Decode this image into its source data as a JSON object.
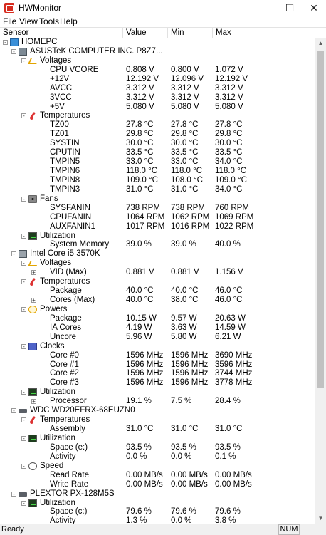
{
  "window": {
    "title": "HWMonitor",
    "minimize": "—",
    "maximize": "☐",
    "close": "✕"
  },
  "menu": [
    "File",
    "View",
    "Tools",
    "Help"
  ],
  "columns": {
    "sensor": "Sensor",
    "value": "Value",
    "min": "Min",
    "max": "Max"
  },
  "tree": [
    {
      "level": 0,
      "kind": "root",
      "icon": "computer",
      "label": "HOMEPC",
      "toggle": "-"
    },
    {
      "level": 1,
      "kind": "device",
      "icon": "board",
      "label": "ASUSTeK COMPUTER INC. P8Z7...",
      "toggle": "-"
    },
    {
      "level": 2,
      "kind": "group",
      "icon": "volt",
      "label": "Voltages",
      "toggle": "-"
    },
    {
      "level": 3,
      "label": "CPU VCORE",
      "value": "0.808 V",
      "min": "0.800 V",
      "max": "1.072 V"
    },
    {
      "level": 3,
      "label": "+12V",
      "value": "12.192 V",
      "min": "12.096 V",
      "max": "12.192 V"
    },
    {
      "level": 3,
      "label": "AVCC",
      "value": "3.312 V",
      "min": "3.312 V",
      "max": "3.312 V"
    },
    {
      "level": 3,
      "label": "3VCC",
      "value": "3.312 V",
      "min": "3.312 V",
      "max": "3.312 V"
    },
    {
      "level": 3,
      "label": "+5V",
      "value": "5.080 V",
      "min": "5.080 V",
      "max": "5.080 V"
    },
    {
      "level": 2,
      "kind": "group",
      "icon": "temp",
      "label": "Temperatures",
      "toggle": "-"
    },
    {
      "level": 3,
      "label": "TZ00",
      "value": "27.8 °C",
      "min": "27.8 °C",
      "max": "27.8 °C"
    },
    {
      "level": 3,
      "label": "TZ01",
      "value": "29.8 °C",
      "min": "29.8 °C",
      "max": "29.8 °C"
    },
    {
      "level": 3,
      "label": "SYSTIN",
      "value": "30.0 °C",
      "min": "30.0 °C",
      "max": "30.0 °C"
    },
    {
      "level": 3,
      "label": "CPUTIN",
      "value": "33.5 °C",
      "min": "33.5 °C",
      "max": "33.5 °C"
    },
    {
      "level": 3,
      "label": "TMPIN5",
      "value": "33.0 °C",
      "min": "33.0 °C",
      "max": "34.0 °C"
    },
    {
      "level": 3,
      "label": "TMPIN6",
      "value": "118.0 °C",
      "min": "118.0 °C",
      "max": "118.0 °C"
    },
    {
      "level": 3,
      "label": "TMPIN8",
      "value": "109.0 °C",
      "min": "108.0 °C",
      "max": "109.0 °C"
    },
    {
      "level": 3,
      "label": "TMPIN3",
      "value": "31.0 °C",
      "min": "31.0 °C",
      "max": "34.0 °C"
    },
    {
      "level": 2,
      "kind": "group",
      "icon": "fan",
      "label": "Fans",
      "toggle": "-"
    },
    {
      "level": 3,
      "label": "SYSFANIN",
      "value": "738 RPM",
      "min": "738 RPM",
      "max": "760 RPM"
    },
    {
      "level": 3,
      "label": "CPUFANIN",
      "value": "1064 RPM",
      "min": "1062 RPM",
      "max": "1069 RPM"
    },
    {
      "level": 3,
      "label": "AUXFANIN1",
      "value": "1017 RPM",
      "min": "1016 RPM",
      "max": "1022 RPM"
    },
    {
      "level": 2,
      "kind": "group",
      "icon": "util",
      "label": "Utilization",
      "toggle": "-"
    },
    {
      "level": 3,
      "label": "System Memory",
      "value": "39.0 %",
      "min": "39.0 %",
      "max": "40.0 %"
    },
    {
      "level": 1,
      "kind": "device",
      "icon": "cpu",
      "label": "Intel Core i5 3570K",
      "toggle": "-"
    },
    {
      "level": 2,
      "kind": "group",
      "icon": "volt",
      "label": "Voltages",
      "toggle": "-"
    },
    {
      "level": 3,
      "label": "VID (Max)",
      "value": "0.881 V",
      "min": "0.881 V",
      "max": "1.156 V",
      "toggle": "+"
    },
    {
      "level": 2,
      "kind": "group",
      "icon": "temp",
      "label": "Temperatures",
      "toggle": "-"
    },
    {
      "level": 3,
      "label": "Package",
      "value": "40.0 °C",
      "min": "40.0 °C",
      "max": "46.0 °C"
    },
    {
      "level": 3,
      "label": "Cores (Max)",
      "value": "40.0 °C",
      "min": "38.0 °C",
      "max": "46.0 °C",
      "toggle": "+"
    },
    {
      "level": 2,
      "kind": "group",
      "icon": "power",
      "label": "Powers",
      "toggle": "-"
    },
    {
      "level": 3,
      "label": "Package",
      "value": "10.15 W",
      "min": "9.57 W",
      "max": "20.63 W"
    },
    {
      "level": 3,
      "label": "IA Cores",
      "value": "4.19 W",
      "min": "3.63 W",
      "max": "14.59 W"
    },
    {
      "level": 3,
      "label": "Uncore",
      "value": "5.96 W",
      "min": "5.80 W",
      "max": "6.21 W"
    },
    {
      "level": 2,
      "kind": "group",
      "icon": "clock",
      "label": "Clocks",
      "toggle": "-"
    },
    {
      "level": 3,
      "label": "Core #0",
      "value": "1596 MHz",
      "min": "1596 MHz",
      "max": "3690 MHz"
    },
    {
      "level": 3,
      "label": "Core #1",
      "value": "1596 MHz",
      "min": "1596 MHz",
      "max": "3596 MHz"
    },
    {
      "level": 3,
      "label": "Core #2",
      "value": "1596 MHz",
      "min": "1596 MHz",
      "max": "3744 MHz"
    },
    {
      "level": 3,
      "label": "Core #3",
      "value": "1596 MHz",
      "min": "1596 MHz",
      "max": "3778 MHz"
    },
    {
      "level": 2,
      "kind": "group",
      "icon": "util",
      "label": "Utilization",
      "toggle": "-"
    },
    {
      "level": 3,
      "label": "Processor",
      "value": "19.1 %",
      "min": "7.5 %",
      "max": "28.4 %",
      "toggle": "+"
    },
    {
      "level": 1,
      "kind": "device",
      "icon": "disk",
      "label": "WDC WD20EFRX-68EUZN0",
      "toggle": "-"
    },
    {
      "level": 2,
      "kind": "group",
      "icon": "temp",
      "label": "Temperatures",
      "toggle": "-"
    },
    {
      "level": 3,
      "label": "Assembly",
      "value": "31.0 °C",
      "min": "31.0 °C",
      "max": "31.0 °C"
    },
    {
      "level": 2,
      "kind": "group",
      "icon": "util",
      "label": "Utilization",
      "toggle": "-"
    },
    {
      "level": 3,
      "label": "Space (e:)",
      "value": "93.5 %",
      "min": "93.5 %",
      "max": "93.5 %"
    },
    {
      "level": 3,
      "label": "Activity",
      "value": "0.0 %",
      "min": "0.0 %",
      "max": "0.1 %"
    },
    {
      "level": 2,
      "kind": "group",
      "icon": "speed",
      "label": "Speed",
      "toggle": "-"
    },
    {
      "level": 3,
      "label": "Read Rate",
      "value": "0.00 MB/s",
      "min": "0.00 MB/s",
      "max": "0.00 MB/s"
    },
    {
      "level": 3,
      "label": "Write Rate",
      "value": "0.00 MB/s",
      "min": "0.00 MB/s",
      "max": "0.00 MB/s"
    },
    {
      "level": 1,
      "kind": "device",
      "icon": "disk",
      "label": "PLEXTOR PX-128M5S",
      "toggle": "-"
    },
    {
      "level": 2,
      "kind": "group",
      "icon": "util",
      "label": "Utilization",
      "toggle": "-"
    },
    {
      "level": 3,
      "label": "Space (c:)",
      "value": "79.6 %",
      "min": "79.6 %",
      "max": "79.6 %"
    },
    {
      "level": 3,
      "label": "Activity",
      "value": "1.3 %",
      "min": "0.0 %",
      "max": "3.8 %"
    }
  ],
  "status": {
    "text": "Ready",
    "num": "NUM"
  }
}
